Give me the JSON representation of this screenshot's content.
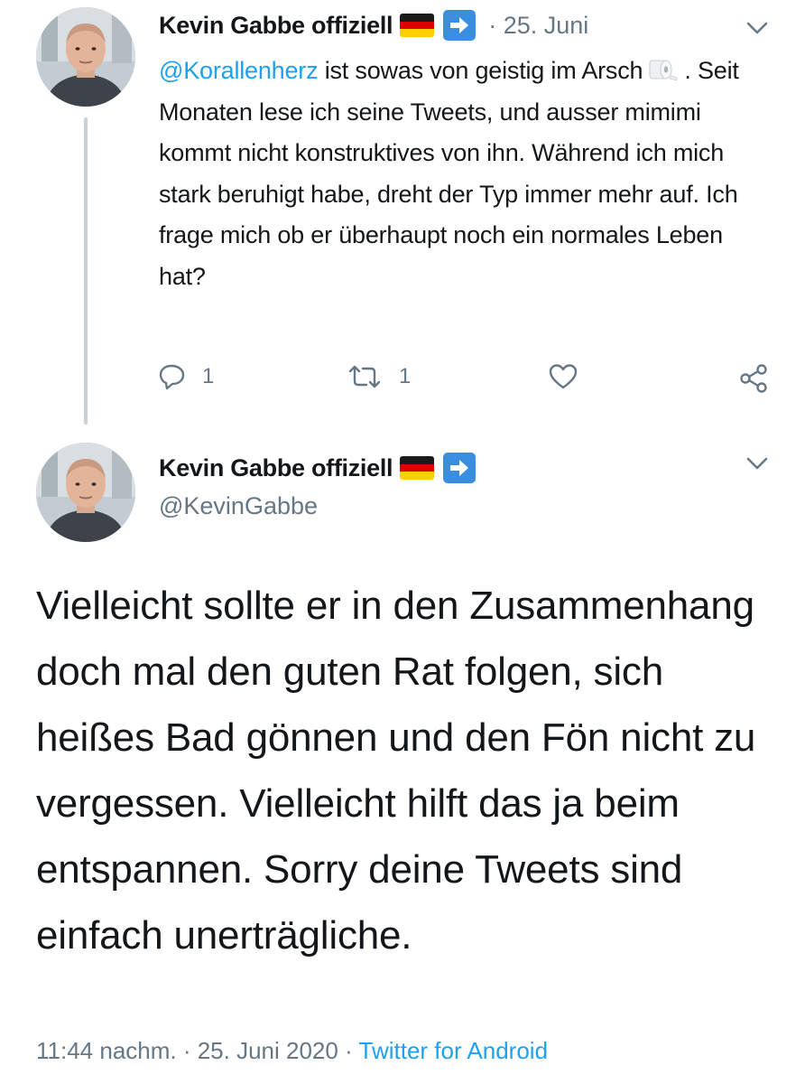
{
  "tweet1": {
    "display_name": "Kevin Gabbe offiziell",
    "date": "· 25. Juni",
    "mention": "@Korallenherz",
    "text_part1": " ist sowas von geistig im Arsch",
    "text_part2": ". Seit Monaten lese ich seine Tweets, und ausser mimimi kommt nicht konstruktives von ihn. Während ich mich stark beruhigt habe, dreht der Typ immer mehr auf. Ich frage mich ob er überhaupt noch ein normales Leben hat?",
    "reply_count": "1",
    "retweet_count": "1"
  },
  "tweet2": {
    "display_name": "Kevin Gabbe offiziell",
    "handle": "@KevinGabbe",
    "text": "Vielleicht sollte er in den Zusammenhang doch mal den guten Rat folgen, sich heißes Bad gönnen und den Fön nicht zu vergessen. Vielleicht hilft das ja beim entspannen. Sorry deine Tweets sind einfach unerträgliche.",
    "time": "11:44 nachm. · 25. Juni 2020 · ",
    "source": "Twitter for Android"
  },
  "colors": {
    "link": "#1da1f2",
    "secondary_text": "#657786",
    "primary_text": "#14171a",
    "thread_line": "#c8d1d9",
    "verified_arrow_box": "#3b8de0"
  },
  "icons": {
    "flag": "germany-flag-icon",
    "arrow": "right-arrow-box-icon",
    "reply": "reply-icon",
    "retweet": "retweet-icon",
    "like": "heart-icon",
    "share": "share-icon",
    "chevron": "chevron-down-icon",
    "emoji": "toilet-roll-icon"
  }
}
